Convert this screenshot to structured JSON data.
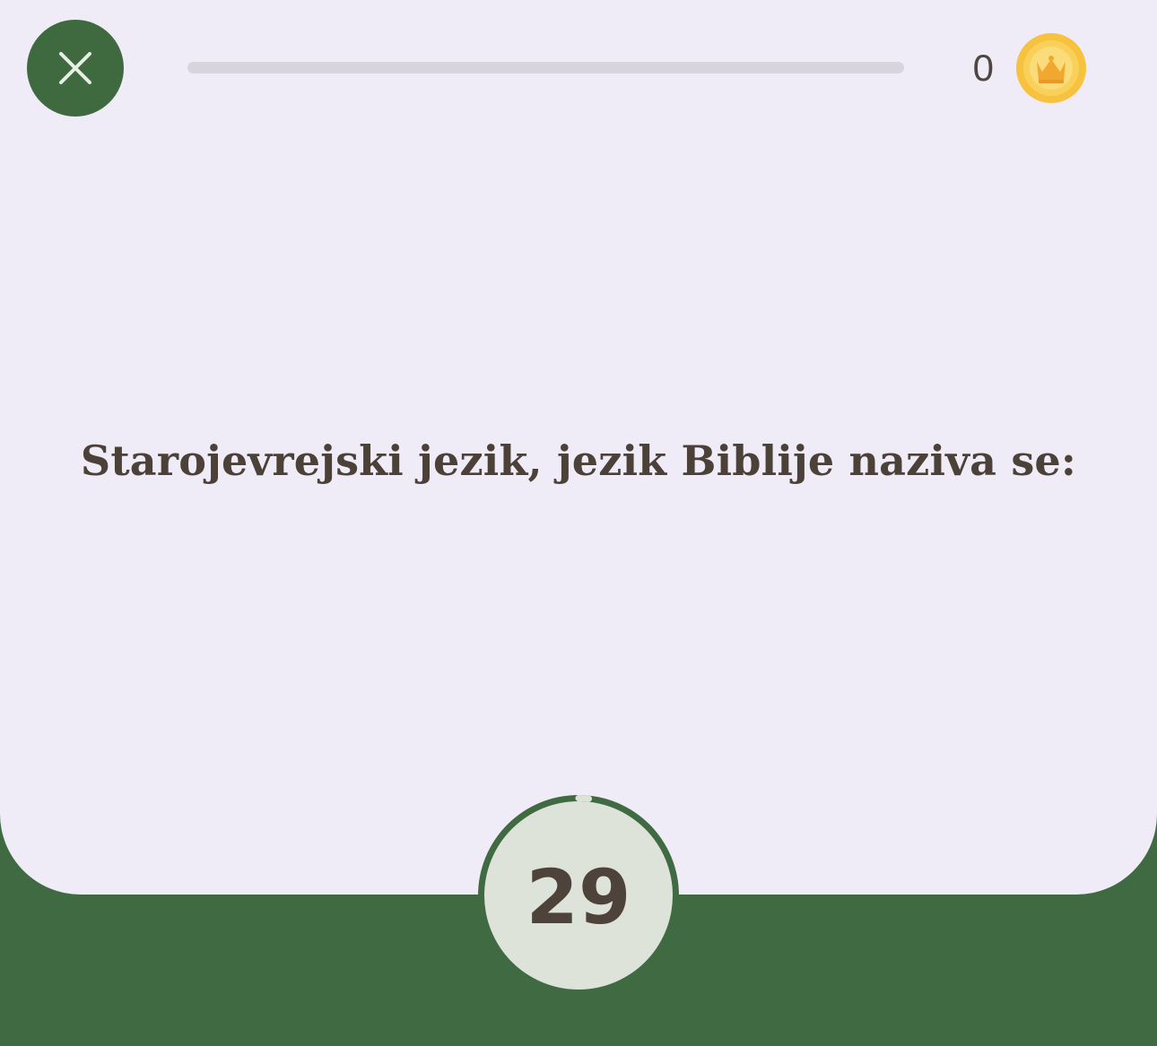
{
  "header": {
    "close_icon": "close-icon",
    "progress_fraction": 0,
    "score": "0",
    "coin_icon": "crown-coin-icon"
  },
  "question": {
    "text": "Starojevrejski jezik, jezik Biblije naziva se:"
  },
  "timer": {
    "seconds_left": "29",
    "remaining_fraction": 0.966
  },
  "colors": {
    "background": "#efecf8",
    "accent_green": "#406a41",
    "text": "#4c4139",
    "timer_face": "#dde3d8",
    "coin_gold": "#f5c340"
  }
}
